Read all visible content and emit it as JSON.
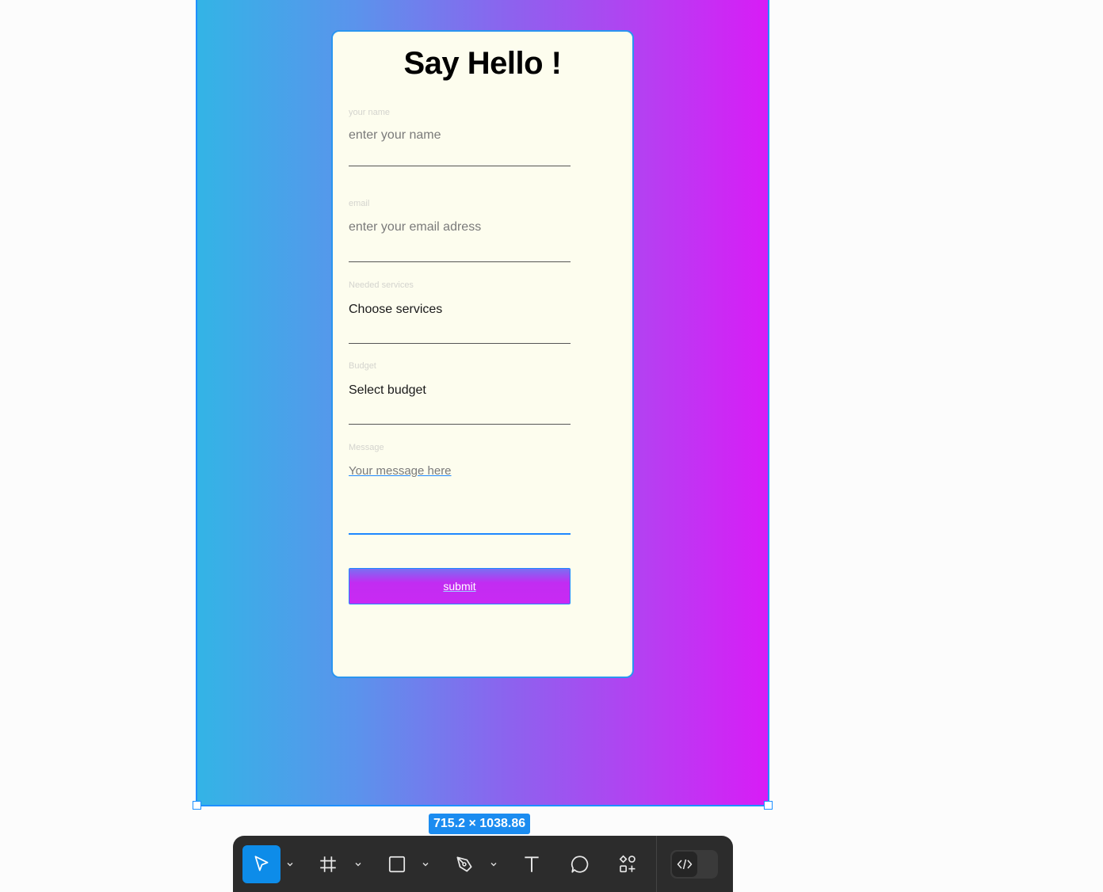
{
  "form": {
    "title": "Say Hello !",
    "fields": [
      {
        "label": "your name",
        "value": "enter your name"
      },
      {
        "label": "email",
        "value": "enter your email adress"
      },
      {
        "label": "Needed services",
        "value": "Choose services"
      },
      {
        "label": "Budget",
        "value": "Select budget"
      },
      {
        "label": "Message",
        "value": "Your message here"
      }
    ],
    "submit_label": "submit"
  },
  "selection": {
    "dimensions": "715.2 × 1038.86"
  },
  "toolbar": {
    "tools": [
      {
        "name": "move-tool",
        "icon": "cursor-icon",
        "active": true
      },
      {
        "name": "frame-tool",
        "icon": "frame-icon",
        "active": false
      },
      {
        "name": "shape-tool",
        "icon": "rectangle-icon",
        "active": false
      },
      {
        "name": "pen-tool",
        "icon": "pen-icon",
        "active": false
      },
      {
        "name": "text-tool",
        "icon": "text-icon",
        "active": false
      },
      {
        "name": "comment-tool",
        "icon": "comment-icon",
        "active": false
      },
      {
        "name": "actions-tool",
        "icon": "components-icon",
        "active": false
      }
    ],
    "dev_mode": {
      "icon": "code-icon",
      "enabled": false
    }
  },
  "colors": {
    "gradient_start": "#33b4e6",
    "gradient_end": "#d81cf6",
    "card_bg": "#fdfdee",
    "selection": "#1e90ff",
    "toolbar_bg": "#2c2c2c",
    "active_tool": "#0d8ce9"
  }
}
